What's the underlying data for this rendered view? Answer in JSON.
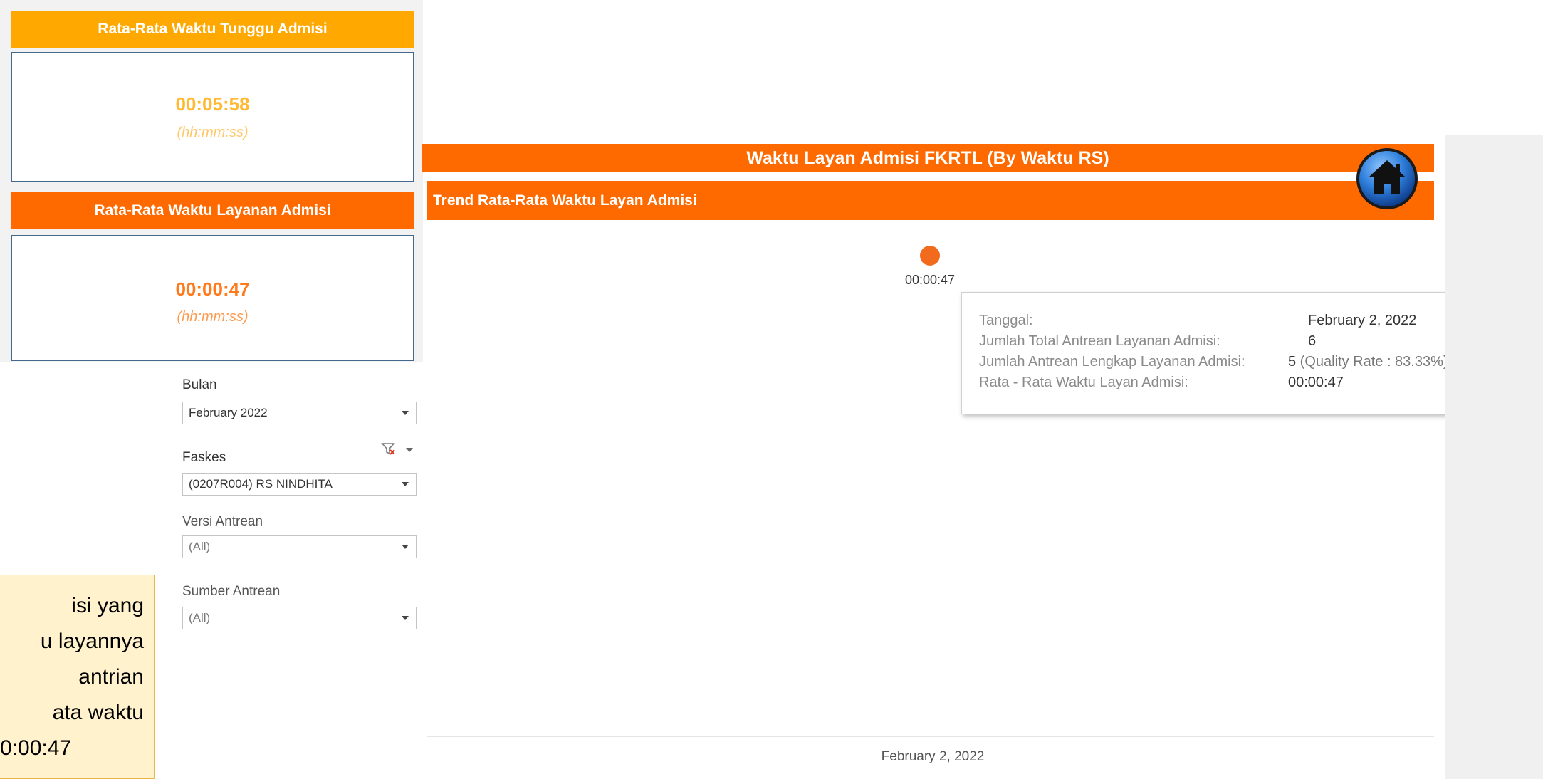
{
  "kpi": {
    "wait": {
      "title": "Rata-Rata Waktu Tunggu Admisi",
      "value": "00:05:58",
      "unit": "(hh:mm:ss)",
      "header_color": "#ffa800",
      "value_color": "#ffb933"
    },
    "service": {
      "title": "Rata-Rata Waktu Layanan Admisi",
      "value": "00:00:47",
      "unit": "(hh:mm:ss)",
      "header_color": "#ff6a00",
      "value_color": "#ff7a1a"
    }
  },
  "filters": {
    "bulan": {
      "label": "Bulan",
      "value": "February 2022"
    },
    "faskes": {
      "label": "Faskes",
      "value": "(0207R004) RS NINDHITA"
    },
    "versi": {
      "label": "Versi Antrean",
      "value": "(All)"
    },
    "sumber": {
      "label": "Sumber Antrean",
      "value": "(All)"
    }
  },
  "note": {
    "lines": [
      "isi   yang",
      "u layannya",
      "antrian",
      "ata  waktu",
      "0:00:47"
    ]
  },
  "chart": {
    "header": "Waktu Layan Admisi FKRTL  (By Waktu RS)",
    "subheader": "Trend Rata-Rata Waktu Layan Admisi",
    "home_icon": "home-icon",
    "accent_color": "#ff6a00"
  },
  "chart_data": {
    "type": "scatter",
    "title": "Trend Rata-Rata Waktu Layan Admisi",
    "x": [
      "February 2, 2022"
    ],
    "values": [
      "00:00:47"
    ],
    "data_labels": [
      "00:00:47"
    ],
    "grid": false
  },
  "tooltip": {
    "rows": [
      {
        "key": "Tanggal:",
        "value": "February 2, 2022",
        "extra": ""
      },
      {
        "key": "Jumlah Total Antrean Layanan Admisi:",
        "value": "6",
        "extra": ""
      },
      {
        "key": "Jumlah Antrean Lengkap Layanan Admisi:",
        "value": "5",
        "extra": " (Quality Rate : 83.33%)"
      },
      {
        "key": "Rata - Rata Waktu Layan Admisi:",
        "value": "00:00:47",
        "extra": ""
      }
    ]
  }
}
